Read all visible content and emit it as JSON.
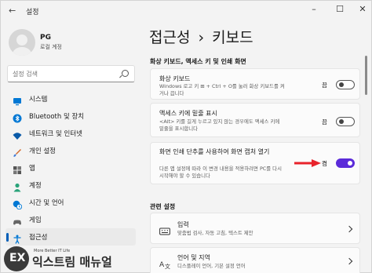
{
  "window": {
    "title": "설정",
    "controls": {
      "minimize": "–",
      "maximize": "☐",
      "close": "✕"
    }
  },
  "profile": {
    "name": "PG",
    "subtitle": "로컬 계정"
  },
  "search": {
    "placeholder": "설정 검색"
  },
  "nav": {
    "items": [
      {
        "label": "시스템",
        "icon": "monitor-icon",
        "color": "#0078d4"
      },
      {
        "label": "Bluetooth 및 장치",
        "icon": "bluetooth-icon",
        "color": "#0078d4"
      },
      {
        "label": "네트워크 및 인터넷",
        "icon": "wifi-icon",
        "color": "#0a5aa8"
      },
      {
        "label": "개인 설정",
        "icon": "brush-icon",
        "color": "#d46a2a"
      },
      {
        "label": "앱",
        "icon": "apps-icon",
        "color": "#555555"
      },
      {
        "label": "계정",
        "icon": "person-icon",
        "color": "#2aa37a"
      },
      {
        "label": "시간 및 언어",
        "icon": "globe-clock-icon",
        "color": "#0078d4"
      },
      {
        "label": "게임",
        "icon": "gamepad-icon",
        "color": "#666666"
      },
      {
        "label": "접근성",
        "icon": "accessibility-icon",
        "color": "#0078d4",
        "active": true
      }
    ]
  },
  "page": {
    "breadcrumb_parent": "접근성",
    "separator": "›",
    "title": "키보드"
  },
  "section1": {
    "title": "화상 키보드, 액세스 키 및 인쇄 화면",
    "rows": [
      {
        "title": "화상 키보드",
        "desc": "Windows 로고 키 ⊞ + Ctrl + O를 눌러 화상 키보드를 켜거나 끕니다",
        "state": "끔",
        "on": false
      },
      {
        "title": "액세스 키에 밑줄 표시",
        "desc": "<Alt> 키를 길게 누르고 있지 않는 경우에도 액세스 키에 밑줄을 표시합니다",
        "state": "끔",
        "on": false
      },
      {
        "title": "화면 인쇄 단추를 사용하여 화면 캡처 열기",
        "desc": "다른 앱 설정에 따라 이 변경 내용을 적용하려면 PC를 다시 시작해야 할 수 있습니다",
        "state": "켬",
        "on": true
      }
    ]
  },
  "section2": {
    "title": "관련 설정",
    "rows": [
      {
        "title": "입력",
        "desc": "맞춤법 검사, 자동 고침, 텍스트 제안",
        "icon": "keyboard-icon"
      },
      {
        "title": "언어 및 지역",
        "desc": "디스플레이 언어, 기본 설정 언어",
        "icon": "language-icon"
      }
    ]
  },
  "watermark": {
    "tagline": "More Better IT Life",
    "name": "익스트림 매뉴얼",
    "logo": "EX"
  },
  "colors": {
    "accent": "#005fb8",
    "toggle_on": "#5b2bd9",
    "arrow": "#e8232b"
  }
}
